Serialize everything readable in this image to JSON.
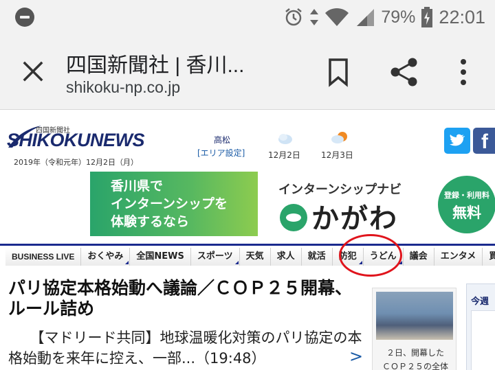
{
  "status_bar": {
    "battery": "79%",
    "time": "22:01",
    "icons": [
      "do-not-disturb-icon",
      "alarm-icon",
      "data-arrows-icon",
      "wifi-icon",
      "signal-icon",
      "battery-icon"
    ]
  },
  "toolbar": {
    "title": "四国新聞社 | 香川...",
    "url": "shikoku-np.co.jp",
    "icons": [
      "close-icon",
      "bookmark-icon",
      "share-icon",
      "more-vert-icon"
    ]
  },
  "site": {
    "logo_small": "四国新聞社",
    "logo_main": "SHIKOKUNEWS",
    "date": "2019年（令和元年）12月2日（月）"
  },
  "weather": {
    "city": "高松",
    "area_setting": "[エリア設定]",
    "day1": "12月2日",
    "day2": "12月3日"
  },
  "social": {
    "facebook_glyph": "f"
  },
  "banner": {
    "left_text": "香川県で\nインターンシップを\n体験するなら",
    "right_sub": "インターンシップナビ",
    "right_main": "かがわ",
    "badge_small": "登録・利用料",
    "badge_large": "無料"
  },
  "nav": {
    "items": [
      "BUSINESS LIVE",
      "おくやみ",
      "全国NEWS",
      "スポーツ",
      "天気",
      "求人",
      "就活",
      "防犯",
      "うどん",
      "議会",
      "エンタメ",
      "買い物"
    ]
  },
  "article": {
    "headline": "パリ協定本格始動へ議論／ＣＯＰ２５開幕、ルール詰め",
    "lede": "【マドリード共同】地球温暖化対策のパリ協定の本格始動を来年に控え、一部...（19:48）",
    "more": ">",
    "photo_caption": "２日、開幕した\nＣＯＰ２５の全体"
  },
  "side": {
    "title": "今週"
  },
  "colors": {
    "nav_line": "#1a2a8e",
    "highlight_circle": "#e0141c",
    "banner_green": "#2aa46a",
    "twitter": "#1da1f2",
    "facebook": "#3b5998"
  }
}
